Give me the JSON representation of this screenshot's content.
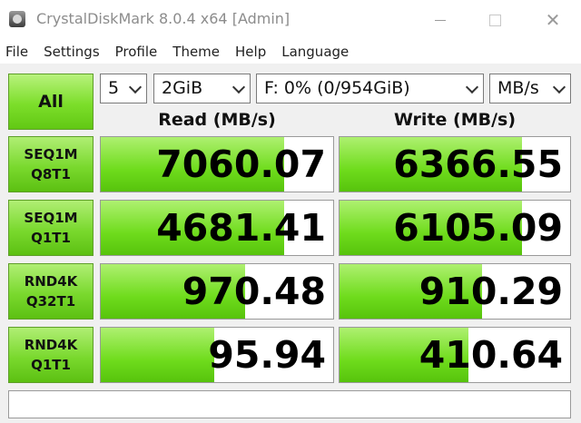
{
  "window": {
    "title": "CrystalDiskMark 8.0.4 x64 [Admin]",
    "controls": [
      "minimize",
      "maximize",
      "close"
    ]
  },
  "menu": [
    "File",
    "Settings",
    "Profile",
    "Theme",
    "Help",
    "Language"
  ],
  "toolbar": {
    "all_label": "All",
    "count": "5",
    "size": "2GiB",
    "drive": "F: 0% (0/954GiB)",
    "unit": "MB/s"
  },
  "headers": {
    "read": "Read (MB/s)",
    "write": "Write (MB/s)"
  },
  "tests": [
    {
      "line1": "SEQ1M",
      "line2": "Q8T1",
      "read": "7060.07",
      "write": "6366.55",
      "read_fill": 0.79,
      "write_fill": 0.79
    },
    {
      "line1": "SEQ1M",
      "line2": "Q1T1",
      "read": "4681.41",
      "write": "6105.09",
      "read_fill": 0.79,
      "write_fill": 0.79
    },
    {
      "line1": "RND4K",
      "line2": "Q32T1",
      "read": "970.48",
      "write": "910.29",
      "read_fill": 0.62,
      "write_fill": 0.62
    },
    {
      "line1": "RND4K",
      "line2": "Q1T1",
      "read": "95.94",
      "write": "410.64",
      "read_fill": 0.49,
      "write_fill": 0.56
    }
  ],
  "status_text": "",
  "colors": {
    "bar_green": "#6fdc1c",
    "button_green": "#7cde2a",
    "title_text": "#8c8c8c"
  }
}
